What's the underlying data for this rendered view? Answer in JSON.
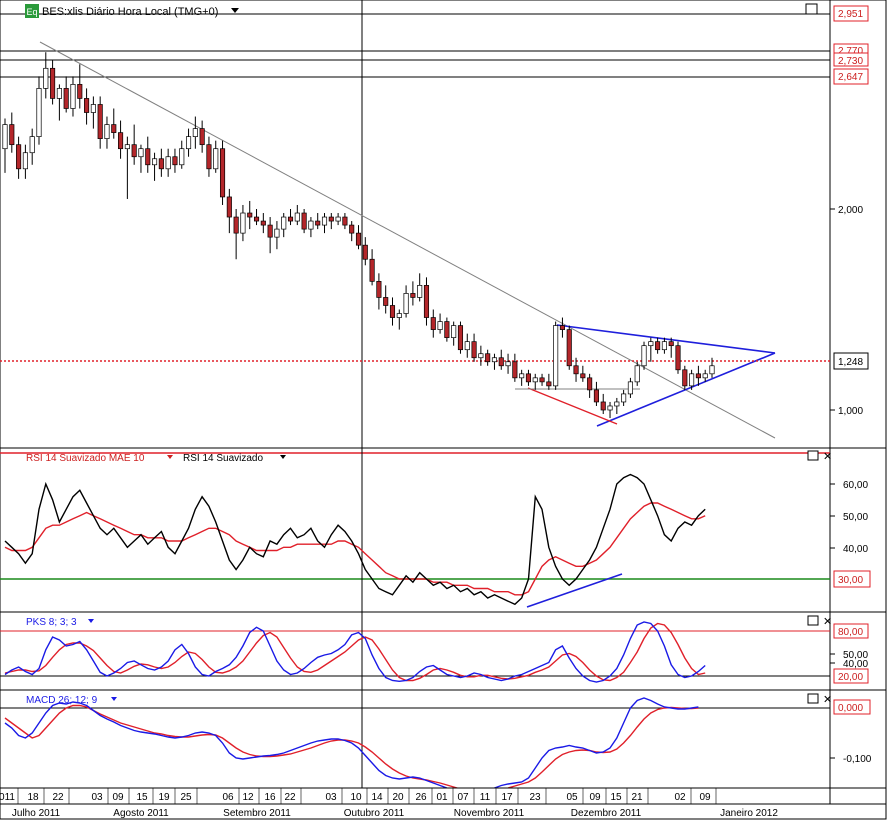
{
  "colors": {
    "bull": "#ffffff",
    "bear": "#b3262a",
    "wick": "#000000",
    "trend_gray": "#808080",
    "triangle": "#1f1fdc",
    "red_line": "#e0202a",
    "price_dot": "#e0202a",
    "rsi": "#000000",
    "rsi_ma": "#e0202a",
    "green_level": "#1a8a1a",
    "blue": "#1a1ae6",
    "red": "#e0202a",
    "label_border": "#e0202a",
    "label_text": "#cc2020",
    "legend_blue": "#1a1ae6"
  },
  "header": {
    "badge": "Eq",
    "title": "BES:xlis Diário Hora Local (TMG+0)",
    "dropdown_icon": "triangle-down-icon"
  },
  "price_panel": {
    "axis_labels": [
      "2,951",
      "2,770",
      "2,730",
      "2,647",
      "2,000",
      "1,248",
      "1,000"
    ],
    "current_price": "1,248"
  },
  "rsi_panel": {
    "legend_1": "RSI 14 Suavizado MAE 10",
    "legend_2": "RSI 14 Suavizado",
    "ticks": [
      "60,00",
      "50,00",
      "40,00",
      "30,00"
    ],
    "level_label": "30,00"
  },
  "pks_panel": {
    "legend": "PKS 8; 3; 3",
    "ticks": [
      "80,00",
      "50,00",
      "40,00",
      "20,00"
    ],
    "upper_label": "80,00",
    "lower_label": "20,00"
  },
  "macd_panel": {
    "legend": "MACD 26; 12; 9",
    "zero_label": "0,000",
    "tick": "-0,100"
  },
  "time_axis": {
    "days": [
      "011",
      "18",
      "22",
      "03",
      "09",
      "15",
      "19",
      "25",
      "06",
      "12",
      "16",
      "22",
      "03",
      "10",
      "14",
      "20",
      "26",
      "01",
      "07",
      "11",
      "17",
      "23",
      "05",
      "09",
      "15",
      "21",
      "02",
      "09"
    ],
    "months": [
      "Julho 2011",
      "Agosto 2011",
      "Setembro 2011",
      "Outubro 2011",
      "Novembro 2011",
      "Dezembro 2011",
      "Janeiro 2012"
    ]
  },
  "chart_data": {
    "type": "candlestick",
    "candles_ohlc": [
      [
        2.3,
        2.45,
        2.18,
        2.42
      ],
      [
        2.42,
        2.48,
        2.28,
        2.32
      ],
      [
        2.32,
        2.36,
        2.15,
        2.2
      ],
      [
        2.2,
        2.32,
        2.15,
        2.28
      ],
      [
        2.28,
        2.4,
        2.22,
        2.36
      ],
      [
        2.36,
        2.66,
        2.32,
        2.6
      ],
      [
        2.6,
        2.78,
        2.55,
        2.7
      ],
      [
        2.7,
        2.74,
        2.52,
        2.55
      ],
      [
        2.55,
        2.62,
        2.44,
        2.6
      ],
      [
        2.6,
        2.66,
        2.48,
        2.5
      ],
      [
        2.5,
        2.66,
        2.46,
        2.62
      ],
      [
        2.62,
        2.72,
        2.5,
        2.55
      ],
      [
        2.55,
        2.6,
        2.42,
        2.48
      ],
      [
        2.48,
        2.56,
        2.4,
        2.52
      ],
      [
        2.52,
        2.56,
        2.3,
        2.35
      ],
      [
        2.35,
        2.46,
        2.3,
        2.42
      ],
      [
        2.42,
        2.5,
        2.35,
        2.38
      ],
      [
        2.38,
        2.44,
        2.25,
        2.3
      ],
      [
        2.3,
        2.36,
        2.05,
        2.32
      ],
      [
        2.32,
        2.42,
        2.22,
        2.26
      ],
      [
        2.26,
        2.32,
        2.18,
        2.3
      ],
      [
        2.3,
        2.36,
        2.18,
        2.22
      ],
      [
        2.22,
        2.28,
        2.14,
        2.25
      ],
      [
        2.25,
        2.3,
        2.16,
        2.2
      ],
      [
        2.2,
        2.3,
        2.16,
        2.26
      ],
      [
        2.26,
        2.3,
        2.18,
        2.22
      ],
      [
        2.22,
        2.34,
        2.2,
        2.3
      ],
      [
        2.3,
        2.4,
        2.26,
        2.36
      ],
      [
        2.36,
        2.46,
        2.3,
        2.4
      ],
      [
        2.4,
        2.44,
        2.28,
        2.32
      ],
      [
        2.32,
        2.36,
        2.16,
        2.2
      ],
      [
        2.2,
        2.34,
        2.18,
        2.3
      ],
      [
        2.3,
        2.34,
        2.02,
        2.06
      ],
      [
        2.06,
        2.1,
        1.88,
        1.96
      ],
      [
        1.96,
        2.0,
        1.75,
        1.88
      ],
      [
        1.88,
        2.02,
        1.84,
        1.98
      ],
      [
        1.98,
        2.04,
        1.9,
        1.96
      ],
      [
        1.96,
        2.0,
        1.92,
        1.94
      ],
      [
        1.94,
        1.98,
        1.88,
        1.92
      ],
      [
        1.92,
        1.96,
        1.78,
        1.86
      ],
      [
        1.86,
        1.94,
        1.8,
        1.9
      ],
      [
        1.9,
        1.98,
        1.86,
        1.96
      ],
      [
        1.96,
        2.0,
        1.92,
        1.94
      ],
      [
        1.94,
        2.02,
        1.92,
        1.98
      ],
      [
        1.98,
        2.0,
        1.88,
        1.9
      ],
      [
        1.9,
        1.96,
        1.86,
        1.94
      ],
      [
        1.94,
        1.98,
        1.9,
        1.92
      ],
      [
        1.92,
        1.98,
        1.88,
        1.96
      ],
      [
        1.96,
        1.98,
        1.9,
        1.94
      ],
      [
        1.94,
        1.98,
        1.92,
        1.96
      ],
      [
        1.96,
        1.98,
        1.9,
        1.92
      ],
      [
        1.92,
        1.94,
        1.84,
        1.88
      ],
      [
        1.88,
        1.92,
        1.8,
        1.82
      ],
      [
        1.82,
        1.86,
        1.72,
        1.75
      ],
      [
        1.75,
        1.8,
        1.62,
        1.64
      ],
      [
        1.64,
        1.68,
        1.5,
        1.56
      ],
      [
        1.56,
        1.62,
        1.48,
        1.52
      ],
      [
        1.52,
        1.56,
        1.42,
        1.46
      ],
      [
        1.46,
        1.5,
        1.4,
        1.48
      ],
      [
        1.48,
        1.62,
        1.46,
        1.58
      ],
      [
        1.58,
        1.64,
        1.52,
        1.56
      ],
      [
        1.56,
        1.68,
        1.54,
        1.62
      ],
      [
        1.62,
        1.66,
        1.42,
        1.46
      ],
      [
        1.46,
        1.5,
        1.36,
        1.4
      ],
      [
        1.4,
        1.48,
        1.38,
        1.44
      ],
      [
        1.44,
        1.46,
        1.34,
        1.36
      ],
      [
        1.36,
        1.44,
        1.32,
        1.42
      ],
      [
        1.42,
        1.44,
        1.28,
        1.3
      ],
      [
        1.3,
        1.38,
        1.26,
        1.34
      ],
      [
        1.34,
        1.38,
        1.24,
        1.26
      ],
      [
        1.26,
        1.32,
        1.22,
        1.28
      ],
      [
        1.28,
        1.3,
        1.22,
        1.24
      ],
      [
        1.24,
        1.28,
        1.2,
        1.26
      ],
      [
        1.26,
        1.3,
        1.2,
        1.22
      ],
      [
        1.22,
        1.28,
        1.18,
        1.24
      ],
      [
        1.24,
        1.28,
        1.14,
        1.16
      ],
      [
        1.16,
        1.2,
        1.12,
        1.18
      ],
      [
        1.18,
        1.2,
        1.12,
        1.14
      ],
      [
        1.14,
        1.18,
        1.1,
        1.16
      ],
      [
        1.16,
        1.18,
        1.12,
        1.14
      ],
      [
        1.14,
        1.18,
        1.1,
        1.12
      ],
      [
        1.12,
        1.44,
        1.1,
        1.42
      ],
      [
        1.42,
        1.46,
        1.36,
        1.4
      ],
      [
        1.4,
        1.42,
        1.2,
        1.22
      ],
      [
        1.22,
        1.26,
        1.14,
        1.18
      ],
      [
        1.18,
        1.22,
        1.14,
        1.16
      ],
      [
        1.16,
        1.18,
        1.06,
        1.1
      ],
      [
        1.1,
        1.14,
        1.02,
        1.04
      ],
      [
        1.04,
        1.08,
        0.98,
        1.0
      ],
      [
        1.0,
        1.04,
        0.96,
        1.02
      ],
      [
        1.02,
        1.06,
        0.98,
        1.04
      ],
      [
        1.04,
        1.1,
        1.02,
        1.08
      ],
      [
        1.08,
        1.16,
        1.06,
        1.14
      ],
      [
        1.14,
        1.24,
        1.12,
        1.22
      ],
      [
        1.22,
        1.34,
        1.2,
        1.32
      ],
      [
        1.32,
        1.36,
        1.24,
        1.34
      ],
      [
        1.34,
        1.36,
        1.28,
        1.3
      ],
      [
        1.3,
        1.36,
        1.28,
        1.34
      ],
      [
        1.34,
        1.36,
        1.26,
        1.32
      ],
      [
        1.32,
        1.34,
        1.18,
        1.2
      ],
      [
        1.2,
        1.22,
        1.1,
        1.12
      ],
      [
        1.12,
        1.2,
        1.1,
        1.18
      ],
      [
        1.18,
        1.22,
        1.12,
        1.16
      ],
      [
        1.16,
        1.2,
        1.14,
        1.18
      ],
      [
        1.18,
        1.26,
        1.16,
        1.22
      ]
    ],
    "price_line": 1.248,
    "rsi": [
      42,
      40,
      38,
      35,
      38,
      52,
      60,
      55,
      48,
      52,
      56,
      58,
      54,
      50,
      46,
      44,
      46,
      43,
      40,
      42,
      44,
      41,
      43,
      45,
      40,
      38,
      42,
      46,
      52,
      56,
      53,
      48,
      42,
      36,
      33,
      36,
      40,
      38,
      37,
      42,
      41,
      44,
      46,
      43,
      44,
      46,
      42,
      40,
      44,
      47,
      45,
      42,
      38,
      33,
      30,
      27,
      26,
      25,
      28,
      31,
      29,
      32,
      30,
      28,
      29,
      27,
      28,
      26,
      27,
      25,
      26,
      24,
      25,
      24,
      23,
      22,
      24,
      30,
      56,
      52,
      40,
      34,
      30,
      28,
      30,
      33,
      36,
      40,
      46,
      52,
      60,
      62,
      63,
      62,
      60,
      55,
      50,
      44,
      42,
      46,
      48,
      47,
      50,
      52
    ],
    "rsi_ma": [
      40,
      39,
      39,
      39,
      40,
      43,
      46,
      47,
      47,
      48,
      49,
      50,
      51,
      50,
      49,
      48,
      47,
      46,
      45,
      44,
      44,
      43,
      43,
      43,
      42,
      42,
      42,
      43,
      44,
      45,
      46,
      46,
      45,
      44,
      42,
      41,
      40,
      39,
      39,
      39,
      39,
      40,
      40,
      41,
      41,
      41,
      41,
      41,
      41,
      42,
      42,
      41,
      40,
      38,
      36,
      34,
      32,
      31,
      30,
      30,
      30,
      30,
      30,
      29,
      29,
      29,
      28,
      28,
      28,
      27,
      27,
      27,
      26,
      26,
      26,
      25,
      25,
      26,
      30,
      34,
      36,
      37,
      36,
      35,
      34,
      34,
      35,
      36,
      38,
      40,
      43,
      46,
      49,
      51,
      53,
      54,
      54,
      53,
      52,
      51,
      50,
      49,
      49,
      50
    ],
    "rsi_level": 30,
    "pks_k": [
      22,
      28,
      32,
      26,
      22,
      30,
      55,
      72,
      68,
      60,
      62,
      66,
      55,
      40,
      25,
      20,
      24,
      30,
      38,
      40,
      35,
      30,
      28,
      32,
      40,
      55,
      62,
      50,
      32,
      22,
      20,
      26,
      30,
      35,
      45,
      60,
      78,
      85,
      80,
      60,
      40,
      28,
      22,
      24,
      30,
      38,
      45,
      48,
      50,
      55,
      62,
      75,
      78,
      70,
      48,
      30,
      18,
      14,
      13,
      14,
      18,
      26,
      32,
      34,
      28,
      22,
      20,
      18,
      20,
      24,
      22,
      18,
      16,
      14,
      16,
      20,
      22,
      26,
      30,
      34,
      38,
      55,
      60,
      44,
      30,
      20,
      14,
      12,
      14,
      20,
      30,
      48,
      70,
      88,
      92,
      90,
      80,
      60,
      35,
      22,
      18,
      20,
      26,
      34
    ],
    "pks_d": [
      24,
      26,
      28,
      28,
      26,
      27,
      34,
      45,
      55,
      62,
      64,
      64,
      60,
      54,
      44,
      34,
      26,
      24,
      28,
      33,
      36,
      35,
      32,
      30,
      32,
      38,
      46,
      52,
      50,
      42,
      32,
      25,
      24,
      27,
      32,
      40,
      52,
      64,
      74,
      78,
      72,
      58,
      44,
      32,
      26,
      25,
      28,
      34,
      40,
      46,
      52,
      60,
      68,
      72,
      68,
      56,
      42,
      28,
      18,
      14,
      14,
      17,
      22,
      28,
      30,
      28,
      25,
      21,
      19,
      19,
      21,
      21,
      19,
      17,
      16,
      17,
      19,
      21,
      25,
      28,
      32,
      40,
      48,
      50,
      46,
      38,
      28,
      20,
      15,
      14,
      18,
      25,
      38,
      52,
      70,
      84,
      90,
      88,
      78,
      62,
      44,
      30,
      22,
      24
    ],
    "pks_levels": [
      80,
      20
    ],
    "macd": [
      -0.03,
      -0.04,
      -0.055,
      -0.06,
      -0.05,
      -0.03,
      -0.01,
      0.005,
      0.01,
      0.008,
      0.012,
      0.01,
      0.005,
      -0.005,
      -0.015,
      -0.022,
      -0.028,
      -0.035,
      -0.04,
      -0.045,
      -0.048,
      -0.05,
      -0.052,
      -0.055,
      -0.058,
      -0.06,
      -0.058,
      -0.055,
      -0.05,
      -0.048,
      -0.05,
      -0.055,
      -0.07,
      -0.09,
      -0.1,
      -0.102,
      -0.1,
      -0.098,
      -0.096,
      -0.095,
      -0.093,
      -0.09,
      -0.085,
      -0.08,
      -0.075,
      -0.07,
      -0.066,
      -0.064,
      -0.062,
      -0.062,
      -0.065,
      -0.07,
      -0.08,
      -0.095,
      -0.11,
      -0.125,
      -0.135,
      -0.14,
      -0.142,
      -0.14,
      -0.138,
      -0.14,
      -0.145,
      -0.15,
      -0.155,
      -0.16,
      -0.163,
      -0.166,
      -0.168,
      -0.17,
      -0.168,
      -0.166,
      -0.16,
      -0.155,
      -0.152,
      -0.15,
      -0.148,
      -0.14,
      -0.12,
      -0.1,
      -0.085,
      -0.08,
      -0.078,
      -0.075,
      -0.078,
      -0.08,
      -0.085,
      -0.09,
      -0.088,
      -0.08,
      -0.06,
      -0.03,
      0.0,
      0.015,
      0.02,
      0.015,
      0.008,
      0.002,
      0.0,
      -0.002,
      -0.002,
      0.0,
      0.002
    ],
    "macd_signal": [
      -0.02,
      -0.03,
      -0.04,
      -0.05,
      -0.06,
      -0.055,
      -0.04,
      -0.025,
      -0.01,
      0.0,
      0.005,
      0.005,
      0.002,
      -0.005,
      -0.012,
      -0.018,
      -0.024,
      -0.03,
      -0.034,
      -0.038,
      -0.042,
      -0.046,
      -0.05,
      -0.052,
      -0.055,
      -0.057,
      -0.058,
      -0.058,
      -0.056,
      -0.054,
      -0.053,
      -0.054,
      -0.06,
      -0.07,
      -0.08,
      -0.088,
      -0.093,
      -0.096,
      -0.097,
      -0.097,
      -0.096,
      -0.094,
      -0.092,
      -0.088,
      -0.084,
      -0.08,
      -0.075,
      -0.07,
      -0.066,
      -0.064,
      -0.064,
      -0.066,
      -0.07,
      -0.078,
      -0.088,
      -0.1,
      -0.112,
      -0.122,
      -0.13,
      -0.136,
      -0.14,
      -0.142,
      -0.144,
      -0.147,
      -0.15,
      -0.154,
      -0.158,
      -0.162,
      -0.165,
      -0.167,
      -0.168,
      -0.168,
      -0.166,
      -0.163,
      -0.16,
      -0.156,
      -0.152,
      -0.148,
      -0.14,
      -0.128,
      -0.115,
      -0.102,
      -0.093,
      -0.088,
      -0.085,
      -0.084,
      -0.085,
      -0.088,
      -0.089,
      -0.088,
      -0.082,
      -0.07,
      -0.055,
      -0.038,
      -0.022,
      -0.01,
      -0.003,
      0.0,
      0.001,
      0.0,
      -0.001,
      -0.001,
      0.0
    ],
    "y_ticks_price": [
      2.951,
      2.77,
      2.73,
      2.647,
      2.0,
      1.0
    ]
  }
}
